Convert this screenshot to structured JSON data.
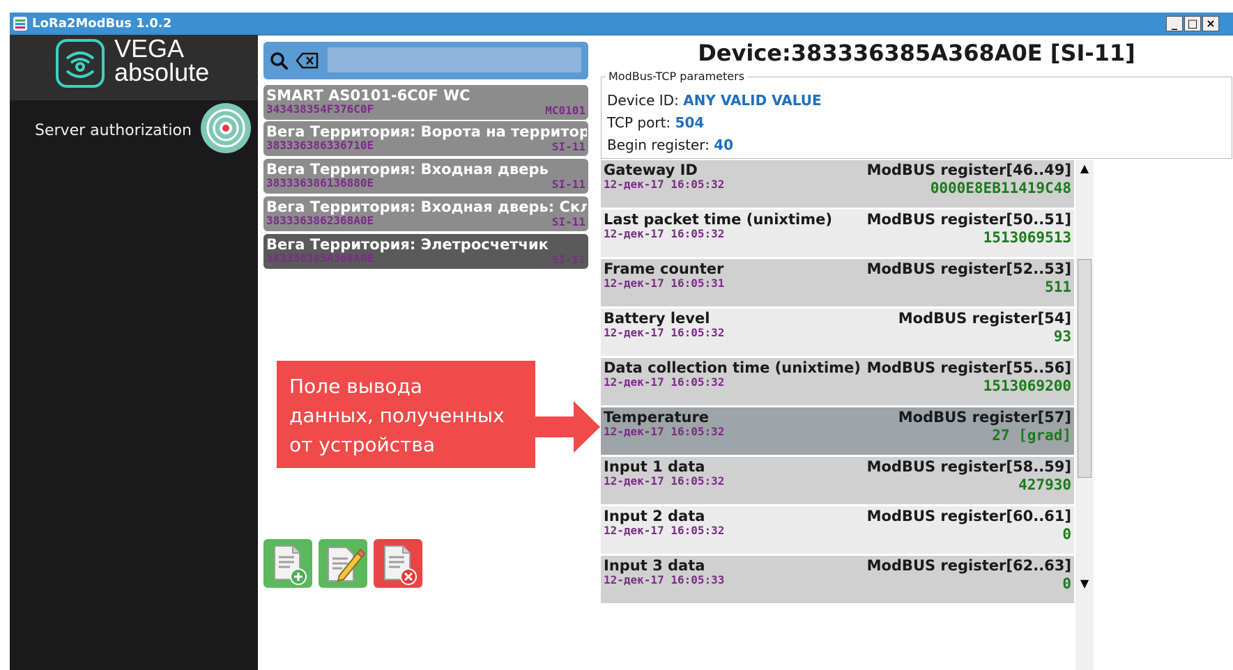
{
  "window": {
    "title": "LoRa2ModBus 1.0.2",
    "minimize_label": "_",
    "maximize_label": "□",
    "close_label": "×"
  },
  "sidebar": {
    "logo_line1": "VEGA",
    "logo_line2": "absolute",
    "auth_label": "Server authorization"
  },
  "search": {
    "placeholder": ""
  },
  "devices": [
    {
      "name": "SMART AS0101-6C0F WC",
      "id": "343438354F376C0F",
      "type": "MC0101",
      "selected": false
    },
    {
      "name": "Вега Территория: Ворота на территорию",
      "id": "383336386336710E",
      "type": "SI-11",
      "selected": false
    },
    {
      "name": "Вега Территория: Входная дверь",
      "id": "383336386136880E",
      "type": "SI-11",
      "selected": false
    },
    {
      "name": "Вега Территория: Входная дверь: Склад",
      "id": "3833363862368A0E",
      "type": "SI-11",
      "selected": false
    },
    {
      "name": "Вега Территория: Элетросчетчик",
      "id": "383336385A368A0E",
      "type": "SI-11",
      "selected": true
    }
  ],
  "actions": [
    {
      "name": "add-device-button",
      "icon": "document-add-icon"
    },
    {
      "name": "edit-device-button",
      "icon": "document-edit-icon"
    },
    {
      "name": "delete-device-button",
      "icon": "document-delete-icon"
    }
  ],
  "callout": {
    "text": "Поле вывода\nданных, полученных\nот устройства"
  },
  "device_panel": {
    "title": "Device:383336385A368A0E [SI-11]",
    "params_legend": "ModBus-TCP parameters",
    "device_id_label": "Device ID: ",
    "device_id_value": "ANY VALID VALUE",
    "tcp_port_label": "TCP port: ",
    "tcp_port_value": "504",
    "begin_register_label": "Begin register: ",
    "begin_register_value": "40"
  },
  "registers": [
    {
      "name": "Gateway ID",
      "time": "12-дек-17 16:05:32",
      "addr": "ModBUS register[46..49]",
      "value": "0000E8EB11419C48",
      "highlight": false
    },
    {
      "name": "Last packet time (unixtime)",
      "time": "12-дек-17 16:05:32",
      "addr": "ModBUS register[50..51]",
      "value": "1513069513",
      "highlight": false
    },
    {
      "name": "Frame counter",
      "time": "12-дек-17 16:05:31",
      "addr": "ModBUS register[52..53]",
      "value": "511",
      "highlight": false
    },
    {
      "name": "Battery level",
      "time": "12-дек-17 16:05:32",
      "addr": "ModBUS register[54]",
      "value": "93",
      "highlight": false
    },
    {
      "name": "Data collection time (unixtime)",
      "time": "12-дек-17 16:05:32",
      "addr": "ModBUS register[55..56]",
      "value": "1513069200",
      "highlight": false
    },
    {
      "name": "Temperature",
      "time": "12-дек-17 16:05:32",
      "addr": "ModBUS register[57]",
      "value": "27 [grad]",
      "highlight": true
    },
    {
      "name": "Input 1 data",
      "time": "12-дек-17 16:05:32",
      "addr": "ModBUS register[58..59]",
      "value": "427930",
      "highlight": false
    },
    {
      "name": "Input 2 data",
      "time": "12-дек-17 16:05:32",
      "addr": "ModBUS register[60..61]",
      "value": "0",
      "highlight": false
    },
    {
      "name": "Input 3 data",
      "time": "12-дек-17 16:05:33",
      "addr": "ModBUS register[62..63]",
      "value": "0",
      "highlight": false
    }
  ],
  "colors": {
    "titlebar": "#3c8fd1",
    "sidebar": "#1a1a1a",
    "search_bar": "#5b9bd5",
    "device_item": "#8c8c8c",
    "device_item_selected": "#5a5a5a",
    "register_row_a": "#d0d0d0",
    "register_row_b": "#ebebeb",
    "register_highlight": "#9ea4a7",
    "callout": "#f04a4a",
    "accent_value": "#1f6fc0",
    "register_value": "#1d7a1d",
    "timestamp": "#7d2a8a"
  }
}
